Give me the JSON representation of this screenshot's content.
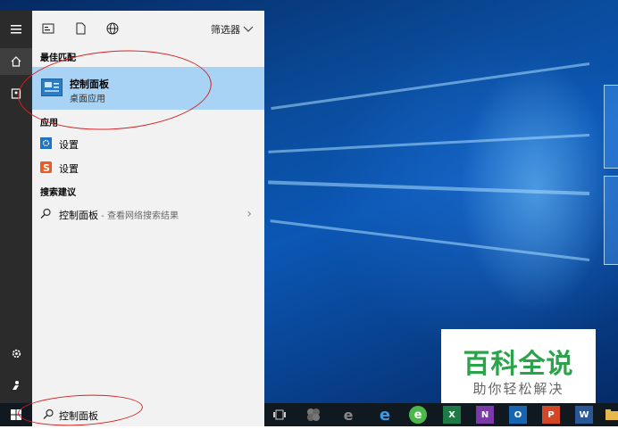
{
  "panel": {
    "filter_label": "筛选器",
    "best_match_header": "最佳匹配",
    "best_match": {
      "title": "控制面板",
      "subtitle": "桌面应用"
    },
    "apps_header": "应用",
    "apps": [
      {
        "label": "设置",
        "icon": "gear-icon"
      },
      {
        "label": "设置",
        "icon": "sogou-icon"
      }
    ],
    "suggestions_header": "搜索建议",
    "suggestion": {
      "label": "控制面板",
      "hint": " - 查看网络搜索结果"
    }
  },
  "search": {
    "value": "控制面板"
  },
  "taskbar": {
    "apps": [
      {
        "name": "task-view-icon",
        "text": ""
      },
      {
        "name": "app-icon",
        "text": ""
      },
      {
        "name": "ie-icon",
        "text": "e"
      },
      {
        "name": "edge-icon",
        "text": "e"
      },
      {
        "name": "browser-icon",
        "text": "e"
      },
      {
        "name": "excel-icon",
        "text": "X"
      },
      {
        "name": "onenote-icon",
        "text": "N"
      },
      {
        "name": "outlook-icon",
        "text": "O"
      },
      {
        "name": "powerpoint-icon",
        "text": "P"
      },
      {
        "name": "word-icon",
        "text": "W"
      },
      {
        "name": "explorer-icon",
        "text": ""
      }
    ]
  },
  "watermark": {
    "title": "百科全说",
    "subtitle": "助你轻松解决"
  },
  "colors": {
    "accent": "#a9d3f4",
    "rail": "#2b2b2b",
    "panel": "#f2f2f2",
    "taskbar": "#101820",
    "watermark_green": "#2aa34a"
  }
}
